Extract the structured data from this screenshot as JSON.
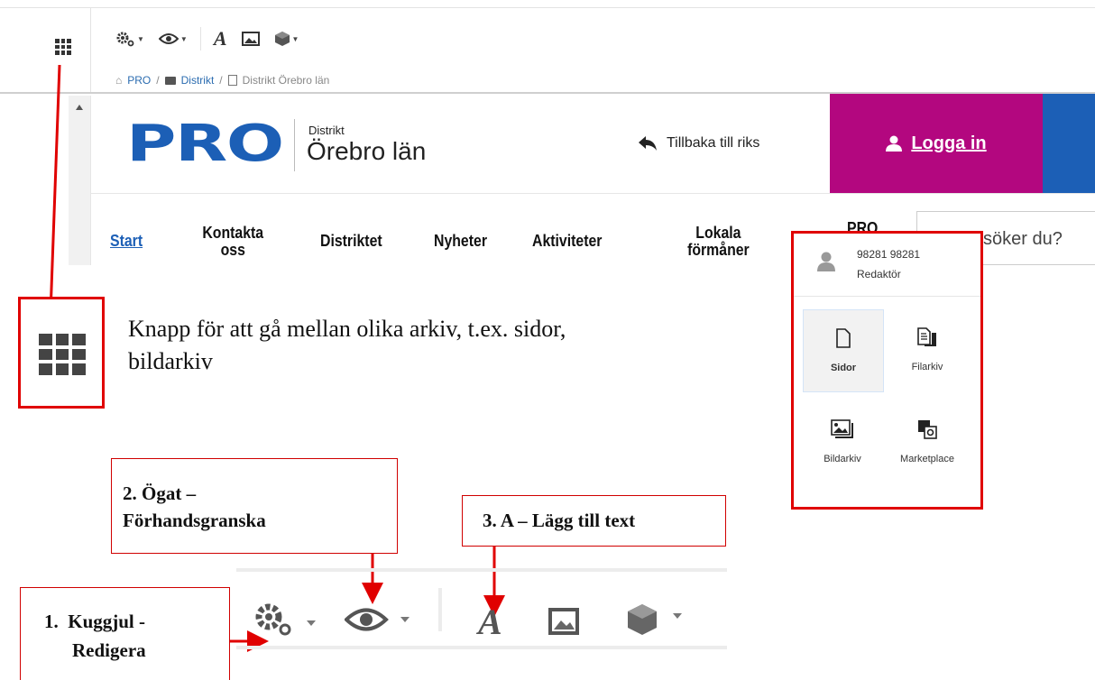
{
  "cms": {
    "breadcrumb": [
      "PRO",
      "Distrikt",
      "Distrikt Örebro län"
    ]
  },
  "site": {
    "logo_text": "PRO",
    "district_small": "Distrikt",
    "district_name": "Örebro län",
    "back_link": "Tillbaka till riks",
    "login_label": "Logga in",
    "search_placeholder": "söker du?",
    "nav": [
      "Start",
      "Kontakta oss",
      "Distriktet",
      "Nyheter",
      "Aktiviteter",
      "Lokala förmåner",
      "PRO"
    ]
  },
  "user_menu": {
    "user_name": "98281 98281",
    "role": "Redaktör",
    "tiles": [
      "Sidor",
      "Filarkiv",
      "Bildarkiv",
      "Marketplace"
    ]
  },
  "annotations": {
    "grid_caption_line1": "Knapp för att gå mellan olika arkiv, t.ex. sidor,",
    "grid_caption_line2": "bildarkiv",
    "label1_line1": "1.  Kuggjul -",
    "label1_line2": "Redigera",
    "label2_line1": "2. Ögat –",
    "label2_line2": "Förhandsgranska",
    "label3": "3. A – Lägg till text"
  },
  "colors": {
    "brand_blue": "#1c5fb6",
    "login_magenta": "#b3077f",
    "annotation_red": "#e00000"
  }
}
